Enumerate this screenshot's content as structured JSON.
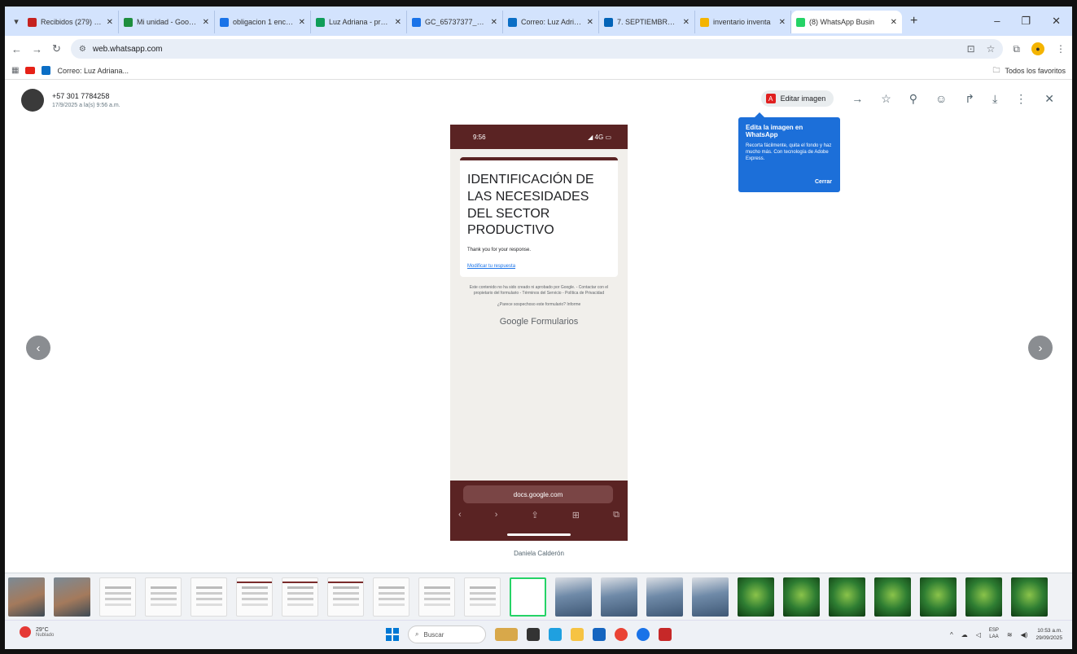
{
  "browser": {
    "tabs": [
      {
        "label": "Recibidos (279) - luz",
        "color": "#c5221f",
        "active": false
      },
      {
        "label": "Mi unidad - Google",
        "color": "#1e8e3e",
        "active": false
      },
      {
        "label": "obligacion 1 encuen",
        "color": "#1a73e8",
        "active": false
      },
      {
        "label": "Luz Adriana - progra",
        "color": "#0f9d58",
        "active": false
      },
      {
        "label": "GC_65737377_3402",
        "color": "#1a73e8",
        "active": false
      },
      {
        "label": "Correo: Luz Adriana",
        "color": "#0b6ec5",
        "active": false
      },
      {
        "label": "7. SEPTIEMBRE - On",
        "color": "#0364b8",
        "active": false
      },
      {
        "label": "inventario inventa",
        "color": "#f4b400",
        "active": false
      },
      {
        "label": "(8) WhatsApp Busin",
        "color": "#25d366",
        "active": true
      }
    ],
    "new_tab": "+",
    "url": "web.whatsapp.com",
    "bookmarks": [
      {
        "label": "Correo: Luz Adriana..."
      }
    ],
    "all_bookmarks": "Todos los favoritos"
  },
  "viewer": {
    "sender_name": "+57 301 7784258",
    "sender_time": "17/9/2025 a la(s) 9:56 a.m.",
    "edit_button": "Editar imagen",
    "tooltip": {
      "title": "Edita la imagen en WhatsApp",
      "body": "Recorta fácilmente, quita el fondo y haz mucho más. Con tecnología de Adobe Express.",
      "close": "Cerrar"
    },
    "caption": "Daniela Calderón"
  },
  "phone": {
    "time": "9:56",
    "signal": "4G",
    "form_title": "IDENTIFICACIÓN DE LAS NECESIDADES DEL SECTOR PRODUCTIVO",
    "thanks": "Thank you for your response.",
    "edit_link": "Modificar tu respuesta",
    "footer": "Este contenido no ha sido creado ni aprobado por Google. - Contactar con el propietario del formulario - Términos del Servicio - Política de Privacidad",
    "footer2": "¿Parece sospechoso este formulario? Informe",
    "google": "Google Formularios",
    "url": "docs.google.com"
  },
  "taskbar": {
    "temp": "29°C",
    "condition": "Nublado",
    "search": "Buscar",
    "lang1": "ESP",
    "lang2": "LAA",
    "time": "10:53 a.m.",
    "date": "29/09/2025"
  },
  "thumbnails": [
    "photo",
    "photo",
    "doc",
    "doc",
    "doc",
    "doc red",
    "doc red",
    "doc red",
    "doc",
    "doc",
    "doc",
    "sel",
    "photo2",
    "photo2",
    "photo2",
    "photo2",
    "green",
    "green",
    "green",
    "green",
    "green",
    "green",
    "green"
  ]
}
